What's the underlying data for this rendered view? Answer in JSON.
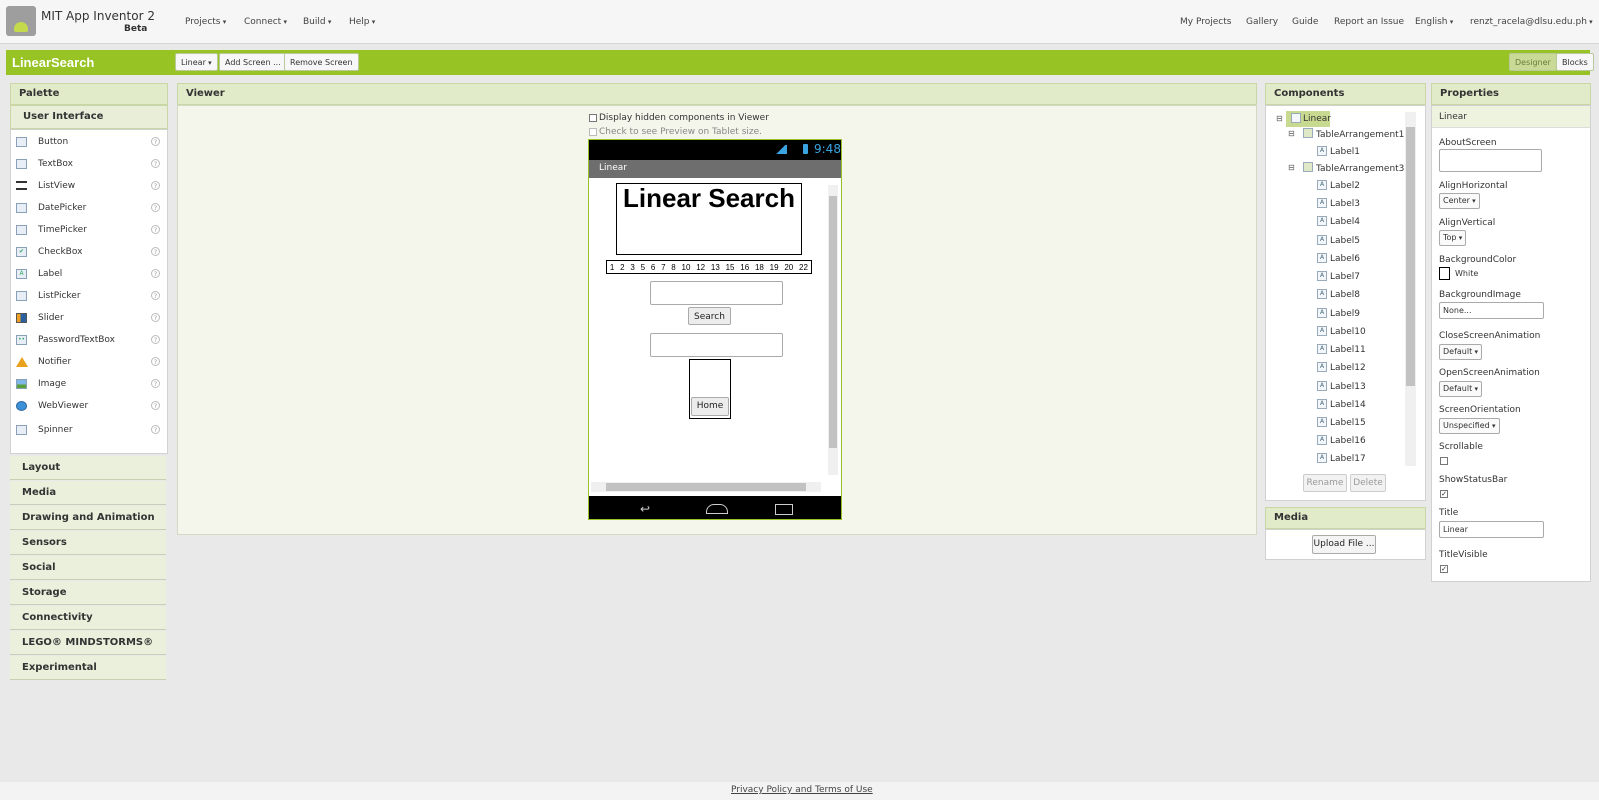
{
  "header": {
    "app_title": "MIT App Inventor 2",
    "beta": "Beta",
    "menus": [
      "Projects",
      "Connect",
      "Build",
      "Help"
    ],
    "right_links": [
      "My Projects",
      "Gallery",
      "Guide",
      "Report an Issue"
    ],
    "language": "English",
    "user": "renzt_racela@dlsu.edu.ph"
  },
  "toolbar": {
    "project_name": "LinearSearch",
    "screen_select": "Linear",
    "add_screen": "Add Screen ...",
    "remove_screen": "Remove Screen",
    "designer": "Designer",
    "blocks": "Blocks"
  },
  "palette": {
    "title": "Palette",
    "section": "User Interface",
    "items": [
      "Button",
      "TextBox",
      "ListView",
      "DatePicker",
      "TimePicker",
      "CheckBox",
      "Label",
      "ListPicker",
      "Slider",
      "PasswordTextBox",
      "Notifier",
      "Image",
      "WebViewer",
      "Spinner"
    ],
    "categories": [
      "Layout",
      "Media",
      "Drawing and Animation",
      "Sensors",
      "Social",
      "Storage",
      "Connectivity",
      "LEGO® MINDSTORMS®",
      "Experimental"
    ]
  },
  "viewer": {
    "title": "Viewer",
    "hidden_components": "Display hidden components in Viewer",
    "tablet_preview": "Check to see Preview on Tablet size.",
    "phone": {
      "time": "9:48",
      "screen_title": "Linear",
      "heading": "Linear Search",
      "numbers": [
        "1",
        "2",
        "3",
        "5",
        "6",
        "7",
        "8",
        "10",
        "12",
        "13",
        "15",
        "16",
        "18",
        "19",
        "20",
        "22"
      ],
      "search_button": "Search",
      "home_button": "Home"
    }
  },
  "components": {
    "title": "Components",
    "root": "Linear",
    "table1": "TableArrangement1",
    "label1": "Label1",
    "table3": "TableArrangement3",
    "labels": [
      "Label2",
      "Label3",
      "Label4",
      "Label5",
      "Label6",
      "Label7",
      "Label8",
      "Label9",
      "Label10",
      "Label11",
      "Label12",
      "Label13",
      "Label14",
      "Label15",
      "Label16",
      "Label17"
    ],
    "rename": "Rename",
    "delete": "Delete"
  },
  "media": {
    "title": "Media",
    "upload": "Upload File ..."
  },
  "properties": {
    "title": "Properties",
    "component": "Linear",
    "about_screen": "AboutScreen",
    "align_horizontal": "AlignHorizontal",
    "align_horizontal_value": "Center",
    "align_vertical": "AlignVertical",
    "align_vertical_value": "Top",
    "background_color": "BackgroundColor",
    "background_color_value": "White",
    "background_image": "BackgroundImage",
    "background_image_value": "None...",
    "close_animation": "CloseScreenAnimation",
    "close_animation_value": "Default",
    "open_animation": "OpenScreenAnimation",
    "open_animation_value": "Default",
    "orientation": "ScreenOrientation",
    "orientation_value": "Unspecified",
    "scrollable": "Scrollable",
    "scrollable_checked": false,
    "show_status_bar": "ShowStatusBar",
    "show_status_bar_checked": true,
    "title_label": "Title",
    "title_value": "Linear",
    "title_visible": "TitleVisible",
    "title_visible_checked": true
  },
  "footer": {
    "privacy": "Privacy Policy and Terms of Use"
  },
  "colors": {
    "accent_green": "#97c424",
    "panel_header": "#e1ebc9"
  }
}
